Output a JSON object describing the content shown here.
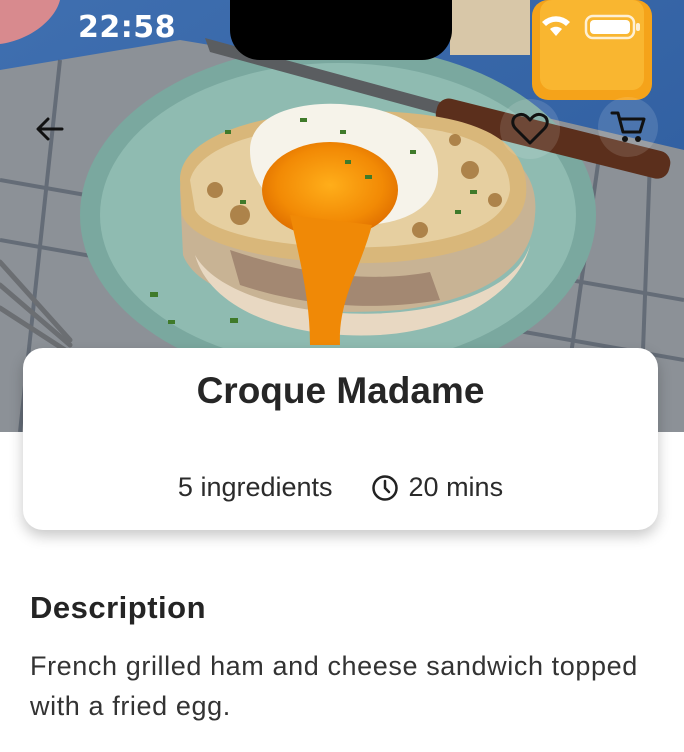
{
  "status_bar": {
    "time": "22:58"
  },
  "recipe": {
    "name": "Croque Madame",
    "ingredients_count": "5 ingredients",
    "duration": "20 mins"
  },
  "description": {
    "heading": "Description",
    "text": "French grilled ham and cheese sandwich topped with a fried egg."
  },
  "icons": {
    "back": "arrow-left-icon",
    "favorite": "heart-outline-icon",
    "cart": "shopping-cart-icon",
    "clock": "clock-icon"
  }
}
